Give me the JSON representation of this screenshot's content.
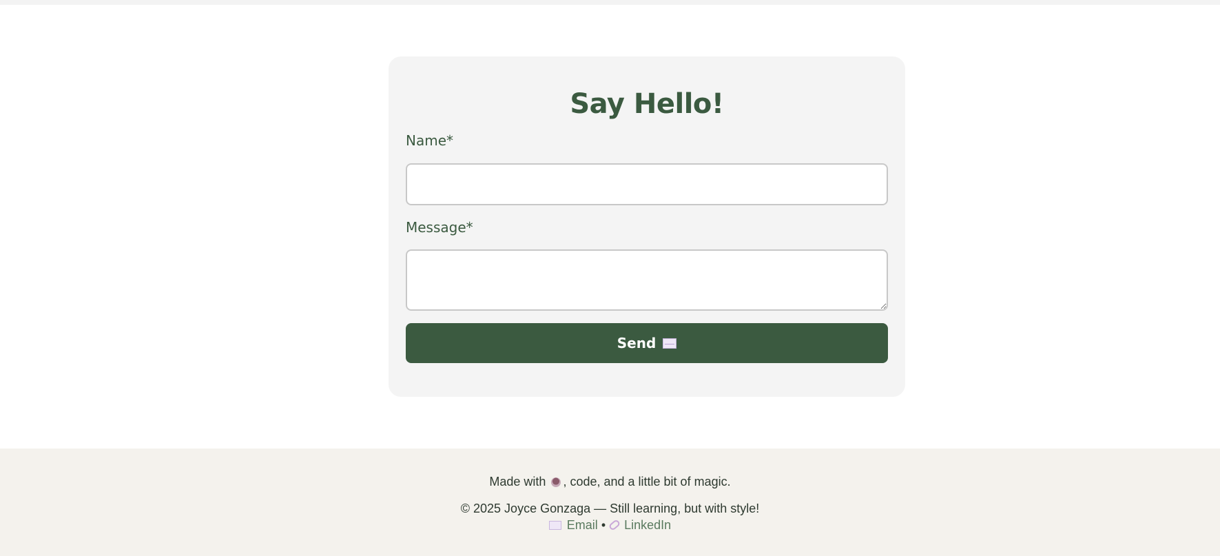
{
  "form": {
    "title": "Say Hello!",
    "name_label": "Name*",
    "name_value": "",
    "message_label": "Message*",
    "message_value": "",
    "send_label": "Send",
    "send_icon": "envelope-icon"
  },
  "footer": {
    "line1_prefix": "Made with",
    "line1_icon": "coffee-icon",
    "line1_suffix": ", code, and a little bit of magic.",
    "copyright": "© 2025 Joyce Gonzaga — Still learning, but with style!",
    "email_icon": "envelope-icon",
    "email_label": "Email",
    "separator": "•",
    "linkedin_icon": "link-icon",
    "linkedin_label": "LinkedIn"
  },
  "colors": {
    "brand_green": "#3b5a40",
    "card_background": "#f4f4f4",
    "footer_background": "#f4f2ed",
    "link_color": "#5a7a5f"
  }
}
